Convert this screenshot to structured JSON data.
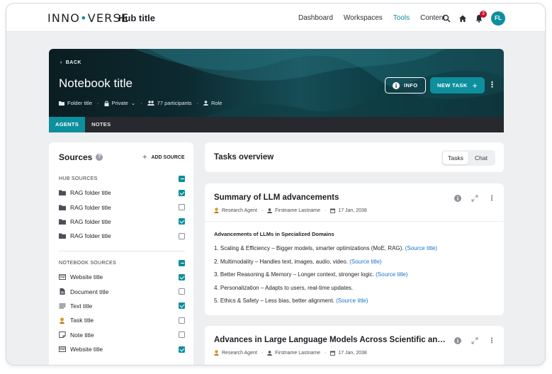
{
  "nav": {
    "logo_left": "INNO",
    "logo_dot": "•",
    "logo_right": "VERSE",
    "hub_title": "Hub title",
    "links": [
      "Dashboard",
      "Workspaces",
      "Tools",
      "Content"
    ],
    "active_link": "Tools",
    "notification_count": "3",
    "avatar_initials": "FL",
    "accent_color": "#0e8f9e"
  },
  "hero": {
    "back_label": "BACK",
    "title": "Notebook title",
    "folder": "Folder title",
    "privacy": "Private",
    "participants": "77 participants",
    "role": "Role",
    "info_label": "INFO",
    "new_task_label": "NEW TASK",
    "tabs": [
      "AGENTS",
      "NOTES"
    ],
    "active_tab": "AGENTS"
  },
  "sources": {
    "title": "Sources",
    "add_label": "ADD SOURCE",
    "hub_header": "HUB SOURCES",
    "hub_items": [
      {
        "label": "RAG folder title",
        "icon": "folder-icon",
        "checked": true
      },
      {
        "label": "RAG folder title",
        "icon": "folder-icon",
        "checked": false
      },
      {
        "label": "RAG folder title",
        "icon": "folder-icon",
        "checked": true
      },
      {
        "label": "RAG folder title",
        "icon": "folder-icon",
        "checked": false
      }
    ],
    "notebook_header": "NOTEBOOK SOURCES",
    "notebook_items": [
      {
        "label": "Website title",
        "icon": "website-icon",
        "checked": true
      },
      {
        "label": "Document title",
        "icon": "document-icon",
        "checked": false
      },
      {
        "label": "Text title",
        "icon": "text-icon",
        "checked": true
      },
      {
        "label": "Task title",
        "icon": "agent-icon",
        "checked": false
      },
      {
        "label": "Note title",
        "icon": "note-icon",
        "checked": false
      },
      {
        "label": "Website title",
        "icon": "website-icon",
        "checked": true
      }
    ]
  },
  "overview": {
    "title": "Tasks overview",
    "toggle": [
      "Tasks",
      "Chat"
    ],
    "selected": "Tasks"
  },
  "tasks": [
    {
      "title": "Summary of LLM advancements",
      "agent": "Research Agent",
      "author": "Firstname Lastname",
      "date": "17 Jan, 2038",
      "heading": "Advancements of LLMs in Specialized Domains",
      "items": [
        {
          "text": "1. Scaling & Efficiency – Bigger models, smarter optimizations (MoE, RAG). ",
          "source": "(Source title)"
        },
        {
          "text": "2. Multimodality – Handles text, images, audio, video. ",
          "source": "(Source title)"
        },
        {
          "text": "3. Better Reasoning & Memory – Longer context, stronger logic. ",
          "source": "(Source title)"
        },
        {
          "text": "4. Personalization – Adapts to users, real-time updates.",
          "source": ""
        },
        {
          "text": "5. Ethics & Safety – Less bias, better alignment. ",
          "source": "(Source title)"
        }
      ]
    },
    {
      "title": "Advances in Large Language Models Across Scientific and Medical Domains",
      "agent": "Research Agent",
      "author": "Firstname Lastname",
      "date": "17 Jan, 2038"
    }
  ]
}
